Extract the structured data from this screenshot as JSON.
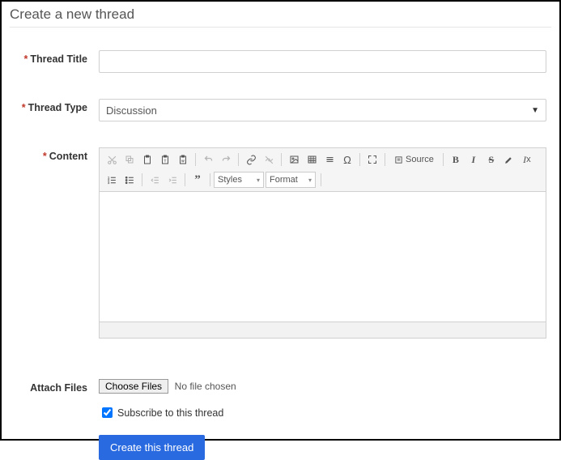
{
  "page": {
    "title": "Create a new thread"
  },
  "labels": {
    "thread_title": "Thread Title",
    "thread_type": "Thread Type",
    "content": "Content",
    "attach_files": "Attach Files"
  },
  "fields": {
    "title_value": "",
    "type_selected": "Discussion"
  },
  "editor": {
    "source_label": "Source",
    "styles_label": "Styles",
    "format_label": "Format"
  },
  "files": {
    "button_label": "Choose Files",
    "status": "No file chosen"
  },
  "subscribe": {
    "label": "Subscribe to this thread",
    "checked": true
  },
  "submit": {
    "label": "Create this thread"
  }
}
